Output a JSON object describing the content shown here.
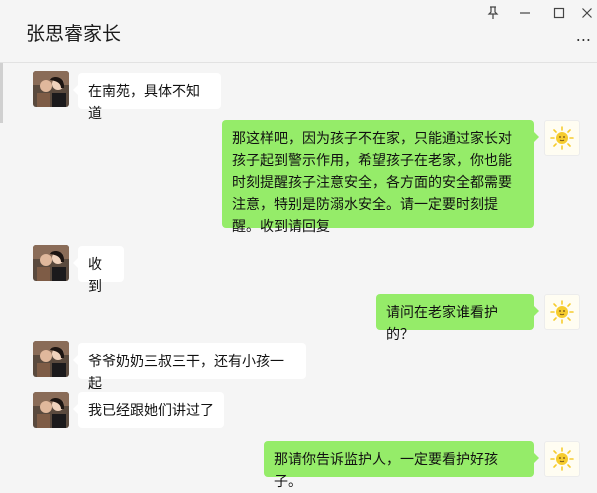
{
  "window": {
    "title": "张思睿家长",
    "pin_icon": "pin-icon",
    "minimize_icon": "minimize-icon",
    "maximize_icon": "maximize-icon",
    "close_icon": "close-icon",
    "more_label": "..."
  },
  "colors": {
    "self_bubble": "#95ec69",
    "other_bubble": "#ffffff",
    "background": "#f5f5f5"
  },
  "messages": [
    {
      "side": "left",
      "text": "在南苑，具体不知道"
    },
    {
      "side": "right",
      "text": "那这样吧，因为孩子不在家，只能通过家长对孩子起到警示作用，希望孩子在老家，你也能时刻提醒孩子注意安全，各方面的安全都需要注意，特别是防溺水安全。请一定要时刻提醒。收到请回复"
    },
    {
      "side": "left",
      "text": "收到"
    },
    {
      "side": "right",
      "text": "请问在老家谁看护的？"
    },
    {
      "side": "left",
      "text": "爷爷奶奶三叔三干，还有小孩一起"
    },
    {
      "side": "left",
      "text": "我已经跟她们讲过了"
    },
    {
      "side": "right",
      "text": "那请你告诉监护人，一定要看护好孩子。"
    }
  ]
}
